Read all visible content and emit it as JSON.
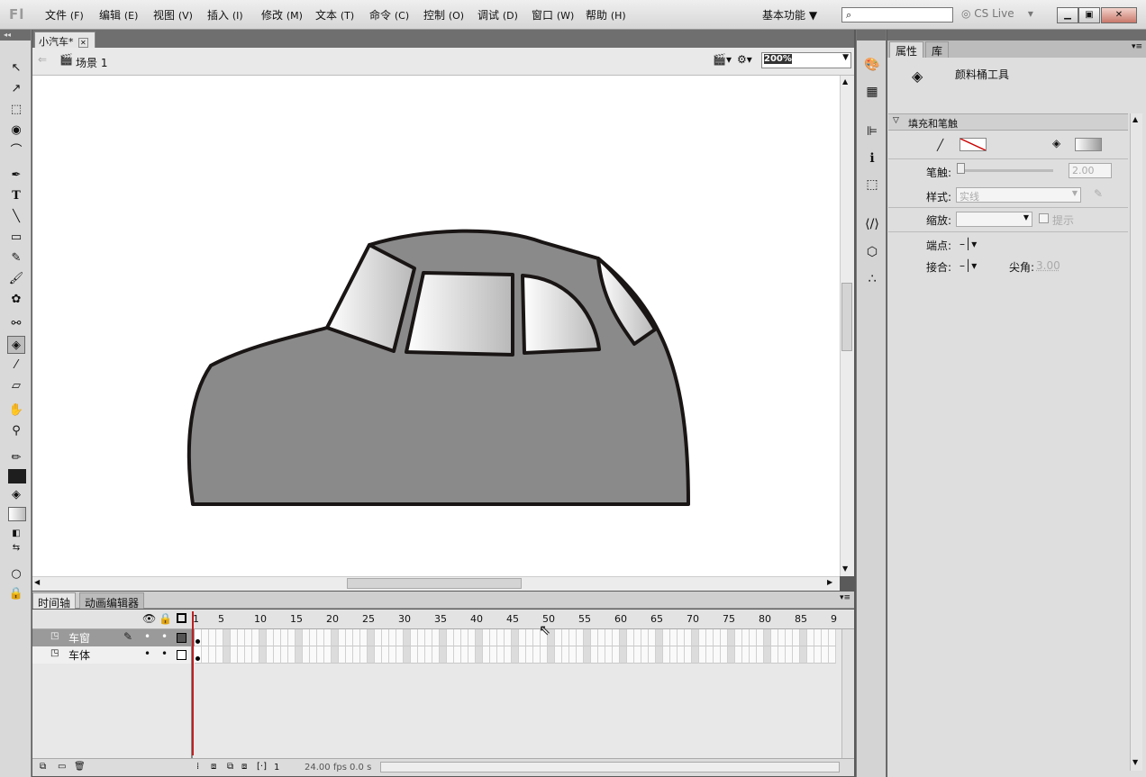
{
  "app": {
    "logo": "Fl"
  },
  "menu": [
    {
      "label": "文件",
      "key": "(F)"
    },
    {
      "label": "编辑",
      "key": "(E)"
    },
    {
      "label": "视图",
      "key": "(V)"
    },
    {
      "label": "插入",
      "key": "(I)"
    },
    {
      "label": "修改",
      "key": "(M)"
    },
    {
      "label": "文本",
      "key": "(T)"
    },
    {
      "label": "命令",
      "key": "(C)"
    },
    {
      "label": "控制",
      "key": "(O)"
    },
    {
      "label": "调试",
      "key": "(D)"
    },
    {
      "label": "窗口",
      "key": "(W)"
    },
    {
      "label": "帮助",
      "key": "(H)"
    }
  ],
  "workspace": "基本功能 ▼",
  "search": {
    "placeholder": ""
  },
  "cs_live": "CS Live",
  "document": {
    "tab": "小汽车*",
    "scene": "场景 1",
    "zoom": "200%"
  },
  "timeline": {
    "tabs": [
      "时间轴",
      "动画编辑器"
    ],
    "frame_labels": [
      "1",
      "5",
      "10",
      "15",
      "20",
      "25",
      "30",
      "35",
      "40",
      "45",
      "50",
      "55",
      "60",
      "65",
      "70",
      "75",
      "80",
      "85",
      "9"
    ],
    "layers": [
      {
        "name": "车窗",
        "selected": true
      },
      {
        "name": "车体",
        "selected": false
      }
    ],
    "footer": {
      "frame": "1",
      "fps": "24.00",
      "fps_unit": "fps",
      "time": "0.0 s"
    }
  },
  "properties": {
    "tabs": [
      "属性",
      "库"
    ],
    "tool_name": "颜料桶工具",
    "section": "填充和笔触",
    "stroke_label": "笔触:",
    "stroke_value": "2.00",
    "style_label": "样式:",
    "style_value": "实线",
    "scale_label": "缩放:",
    "hint_label": "提示",
    "cap_label": "端点:",
    "join_label": "接合:",
    "miter_label": "尖角:",
    "miter_value": "3.00"
  },
  "colors": {
    "car_body": "#8a8a8a",
    "outline": "#1a1515",
    "selected_layer": "#9a9a9a"
  }
}
